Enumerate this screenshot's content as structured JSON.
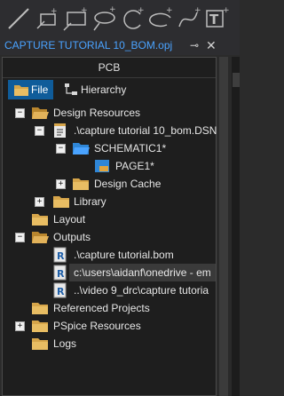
{
  "window": {
    "title": "CAPTURE TUTORIAL 10_BOM.opj",
    "pin_glyph": "⊸",
    "close_glyph": "✕"
  },
  "toolbar": {
    "icons": [
      "line-icon",
      "place-pin-icon",
      "rectangle-icon",
      "ellipse-icon",
      "arc-icon",
      "elliptical-arc-icon",
      "bezier-icon",
      "text-icon"
    ]
  },
  "panel": {
    "header": "PCB",
    "tabs": [
      {
        "label": "File",
        "icon": "folder-icon",
        "active": true
      },
      {
        "label": "Hierarchy",
        "icon": "hierarchy-icon",
        "active": false
      }
    ],
    "tree": [
      {
        "label": "Design Resources",
        "expander": "-",
        "icon": "folder-open-icon"
      },
      {
        "label": ".\\capture tutorial 10_bom.DSN",
        "expander": "-",
        "icon": "design-file-icon"
      },
      {
        "label": "SCHEMATIC1*",
        "expander": "-",
        "icon": "schematic-folder-icon"
      },
      {
        "label": "PAGE1*",
        "expander": "",
        "icon": "page-icon"
      },
      {
        "label": "Design Cache",
        "expander": "+",
        "icon": "folder-icon"
      },
      {
        "label": "Library",
        "expander": "+",
        "icon": "folder-icon"
      },
      {
        "label": "Layout",
        "expander": "",
        "icon": "folder-icon"
      },
      {
        "label": "Outputs",
        "expander": "-",
        "icon": "folder-open-icon"
      },
      {
        "label": ".\\capture tutorial.bom",
        "expander": "",
        "icon": "report-file-icon"
      },
      {
        "label": "c:\\users\\aidanf\\onedrive - em",
        "expander": "",
        "icon": "report-file-icon",
        "selected": true
      },
      {
        "label": "..\\video 9_drc\\capture tutoria",
        "expander": "",
        "icon": "report-file-icon"
      },
      {
        "label": "Referenced Projects",
        "expander": "",
        "icon": "folder-icon"
      },
      {
        "label": "PSpice Resources",
        "expander": "+",
        "icon": "folder-icon"
      },
      {
        "label": "Logs",
        "expander": "",
        "icon": "folder-icon"
      }
    ]
  },
  "colors": {
    "title": "#4aa3ff",
    "active_tab": "#0f5c9a",
    "folder": "#d6a54a",
    "panel_bg": "#1e1e1e"
  }
}
